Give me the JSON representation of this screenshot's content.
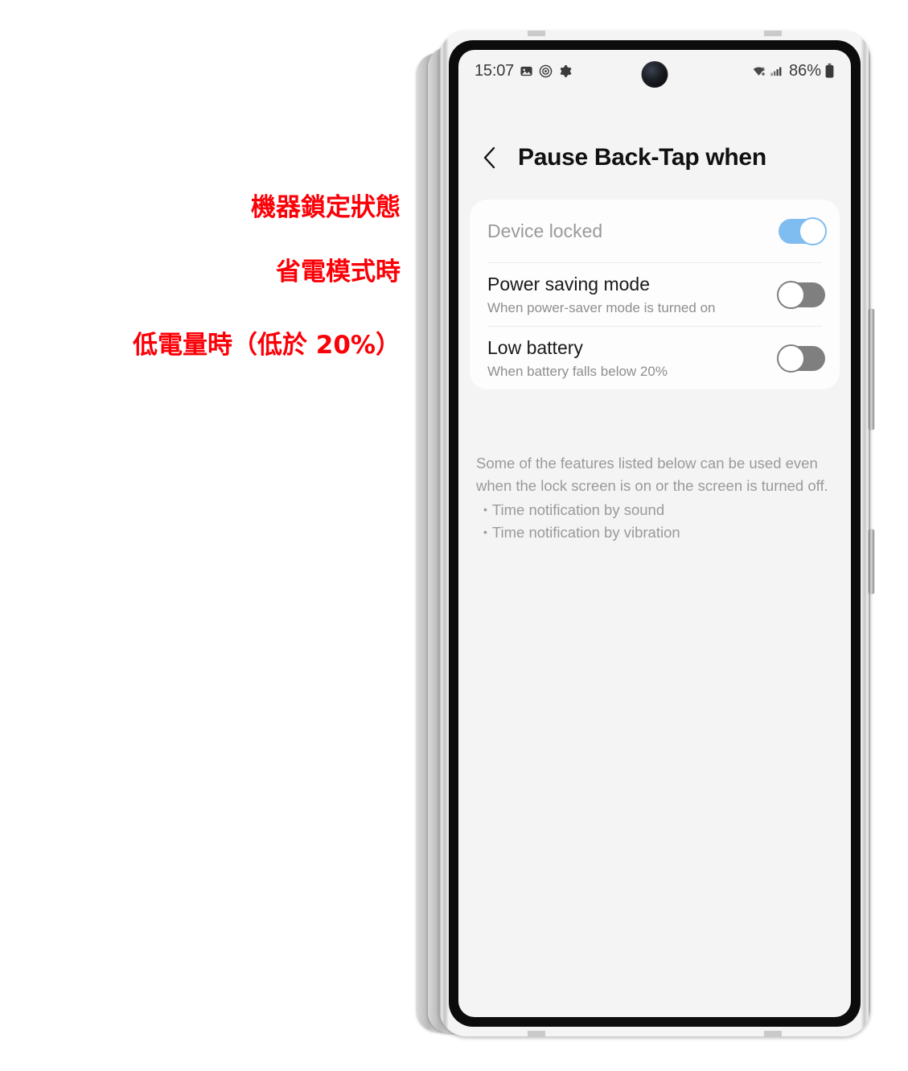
{
  "annotations": [
    {
      "text": "機器鎖定狀態"
    },
    {
      "text": "省電模式時"
    },
    {
      "text": "低電量時（低於 20%）"
    }
  ],
  "phone": {
    "status_bar": {
      "time": "15:07",
      "left_icons": [
        "image-icon",
        "screen-recorder-icon",
        "settings-gear-icon"
      ],
      "right_icons": [
        "wifi-icon",
        "cellular-signal-icon"
      ],
      "battery_percent": "86%",
      "battery_icon": "battery-icon"
    },
    "header": {
      "back_icon": "chevron-left-icon",
      "title": "Pause Back-Tap when"
    },
    "settings": [
      {
        "title": "Device locked",
        "subtitle": "",
        "toggle": "on",
        "disabled": true
      },
      {
        "title": "Power saving mode",
        "subtitle": "When power-saver mode is turned on",
        "toggle": "off",
        "disabled": false
      },
      {
        "title": "Low battery",
        "subtitle": "When battery falls below 20%",
        "toggle": "off",
        "disabled": false
      }
    ],
    "footer": {
      "paragraph": "Some of the features listed below can be used even when the lock screen is on or the screen is turned off.",
      "bullets": [
        "Time notification by sound",
        "Time notification by vibration"
      ]
    }
  },
  "colors": {
    "annotation_red": "#fb0007",
    "toggle_on": "#7fbdf0",
    "toggle_off": "#7f7f7f",
    "screen_bg": "#f4f4f4",
    "card_bg": "#fdfdfd"
  }
}
